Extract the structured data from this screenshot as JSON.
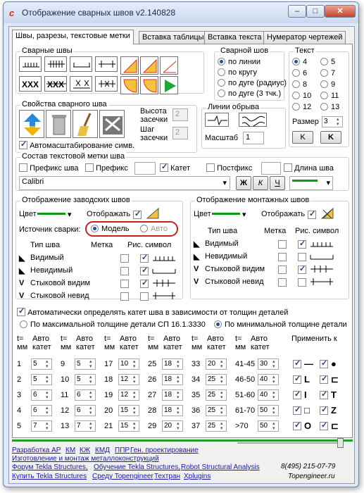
{
  "window": {
    "title": "Отображение сварных швов v2.140828",
    "icon": "app-c-icon"
  },
  "tabs": [
    "Швы, разрезы, текстовые метки",
    "Вставка таблицы",
    "Вставка текста",
    "Нумератор чертежей"
  ],
  "welds": {
    "label": "Сварные швы"
  },
  "weld_type": {
    "label": "Сварной шов",
    "options": [
      "по линии",
      "по кругу",
      "по дуге (радиус)",
      "по дуге (3 тчк.)"
    ],
    "selected": 0
  },
  "text_group": {
    "label": "Текст",
    "numbers": [
      "4",
      "5",
      "6",
      "7",
      "8",
      "9",
      "10",
      "11",
      "12",
      "13"
    ],
    "selected": "4",
    "size_label": "Размер",
    "size_value": "3",
    "k1": "K",
    "k2": "K"
  },
  "props": {
    "label": "Свойства сварного шва",
    "h_label": "Высота",
    "h_label2": "засечки",
    "h_value": "2",
    "s_label": "Шаг",
    "s_label2": "засечки",
    "s_value": "2",
    "auto_label": "Автомасштабирование симв."
  },
  "break_line": {
    "label": "Линии обрыва",
    "scale_label": "Масштаб",
    "scale_value": "1"
  },
  "text_mark": {
    "label": "Состав текстовой метки шва",
    "prefix_weld": "Префикс шва",
    "prefix": "Префикс",
    "leg": "Катет",
    "postfix": "Постфикс",
    "length": "Длина шва",
    "font": "Calibri",
    "b": "Ж",
    "i": "К",
    "u": "Ч"
  },
  "factory": {
    "label": "Отображение заводских швов",
    "color": "Цвет",
    "show": "Отображать",
    "source": "Источник сварки:",
    "model": "Модель",
    "auto": "Авто",
    "col_type": "Тип шва",
    "col_mark": "Метка",
    "col_sym": "Рис. символ",
    "rows": [
      "Видимый",
      "Невидимый",
      "Стыковой видим",
      "Стыковой невид"
    ]
  },
  "mount": {
    "label": "Отображение монтажных швов",
    "color": "Цвет",
    "show": "Отображать",
    "col_type": "Тип шва",
    "col_mark": "Метка",
    "col_sym": "Рис. символ",
    "rows": [
      "Видимый",
      "Невидимый",
      "Стыковой видим",
      "Стыковой невид"
    ]
  },
  "auto_leg": {
    "label": "Автоматически определять катет шва в зависимости от толщин деталей",
    "opt1": "По максимальной толщине детали СП 16.1.3330",
    "opt2": "По минимальной толщине детали"
  },
  "leg_table": {
    "t": "t=",
    "auto": "Авто",
    "mm": "мм",
    "leg": "катет",
    "apply": "Применить к",
    "cols": [
      {
        "rows": [
          [
            "1",
            "5"
          ],
          [
            "2",
            "5"
          ],
          [
            "3",
            "6"
          ],
          [
            "4",
            "6"
          ],
          [
            "5",
            "7"
          ]
        ]
      },
      {
        "rows": [
          [
            "9",
            "5"
          ],
          [
            "10",
            "5"
          ],
          [
            "11",
            "6"
          ],
          [
            "12",
            "6"
          ],
          [
            "13",
            "7"
          ]
        ]
      },
      {
        "rows": [
          [
            "17",
            "10"
          ],
          [
            "18",
            "12"
          ],
          [
            "19",
            "12"
          ],
          [
            "20",
            "15"
          ],
          [
            "21",
            "15"
          ]
        ]
      },
      {
        "rows": [
          [
            "25",
            "18"
          ],
          [
            "26",
            "18"
          ],
          [
            "27",
            "18"
          ],
          [
            "28",
            "18"
          ],
          [
            "29",
            "20"
          ]
        ]
      },
      {
        "rows": [
          [
            "33",
            "20"
          ],
          [
            "34",
            "25"
          ],
          [
            "35",
            "25"
          ],
          [
            "36",
            "25"
          ],
          [
            "37",
            "25"
          ]
        ]
      },
      {
        "rows": [
          [
            "41-45",
            "30"
          ],
          [
            "46-50",
            "40"
          ],
          [
            "51-60",
            "40"
          ],
          [
            "61-70",
            "50"
          ],
          [
            ">70",
            "50"
          ]
        ]
      }
    ]
  },
  "links": {
    "l1": "Разработка АР",
    "l2": "КМ",
    "l3": "КЖ",
    "l4": "КМД",
    "l5": "ППР",
    "l6": "Ген. проектирование",
    "l7": "Изготовление и монтаж металлоконструкций",
    "l8": "Форум Tekla Structures,",
    "l9": "Обучение Tekla Structures,",
    "l10": "Robot Structural Analysis",
    "l11": "Купить Tekla Structures",
    "l12": "Среду Topengineer",
    "l13": "Техтран",
    "l14": "Xplugins",
    "phone": "8(495) 215-07-79",
    "site": "Topengineer.ru"
  },
  "colors": {
    "accent": "#0a9a16",
    "highlight": "#c0241c",
    "link": "#1a1aa6"
  }
}
